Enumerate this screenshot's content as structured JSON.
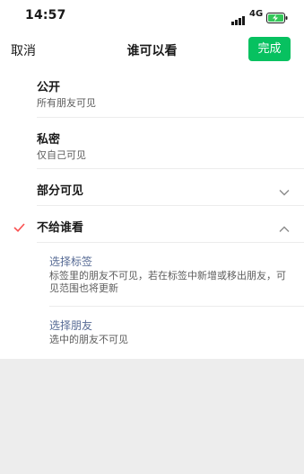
{
  "status_bar": {
    "time": "14:57",
    "network": "4G",
    "icons": [
      "signal-icon",
      "battery-charging-icon"
    ]
  },
  "nav": {
    "cancel_label": "取消",
    "title": "谁可以看",
    "done_label": "完成",
    "accent_color": "#07c160"
  },
  "options": [
    {
      "title": "公开",
      "desc": "所有朋友可见",
      "selected": false
    },
    {
      "title": "私密",
      "desc": "仅自己可见",
      "selected": false
    },
    {
      "title": "部分可见",
      "expanded": false,
      "selected": false
    },
    {
      "title": "不给谁看",
      "expanded": true,
      "selected": true
    }
  ],
  "sub_options": [
    {
      "title": "选择标签",
      "desc": "标签里的朋友不可见，若在标签中新增或移出朋友，可见范围也将更新"
    },
    {
      "title": "选择朋友",
      "desc": "选中的朋友不可见"
    }
  ],
  "colors": {
    "check": "#fa5151",
    "link": "#576b95",
    "background": "#ededed"
  }
}
